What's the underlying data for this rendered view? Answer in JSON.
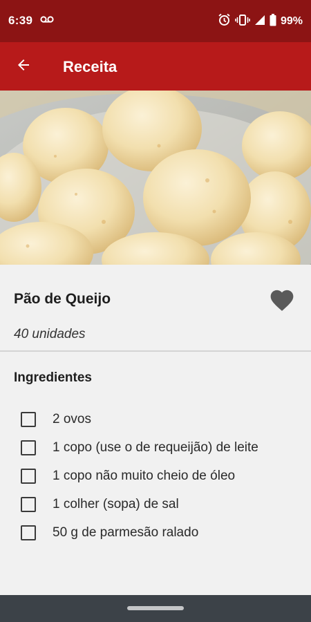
{
  "status_bar": {
    "time": "6:39",
    "left_icon": "voicemail-icon",
    "right_icons": [
      "alarm-icon",
      "vibrate-icon",
      "signal-icon",
      "battery-icon"
    ],
    "battery": "99%"
  },
  "app_bar": {
    "title": "Receita",
    "back_icon": "arrow-left-icon"
  },
  "hero_image": {
    "subject": "pão de queijo photo"
  },
  "recipe": {
    "title": "Pão de Queijo",
    "yield": "40 unidades",
    "favorite_icon": "heart-icon",
    "ingredients_heading": "Ingredientes",
    "ingredients": [
      {
        "text": "2 ovos",
        "checked": false
      },
      {
        "text": "1 copo (use o de requeijão) de leite",
        "checked": false
      },
      {
        "text": "1 copo não muito cheio de óleo",
        "checked": false
      },
      {
        "text": "1 colher (sopa) de sal",
        "checked": false
      },
      {
        "text": "50 g de parmesão ralado",
        "checked": false
      }
    ]
  },
  "colors": {
    "status_bar": "#8c1414",
    "app_bar": "#b71a1a",
    "content_bg": "#f1f1f1",
    "nav_bar": "#3c4248"
  }
}
